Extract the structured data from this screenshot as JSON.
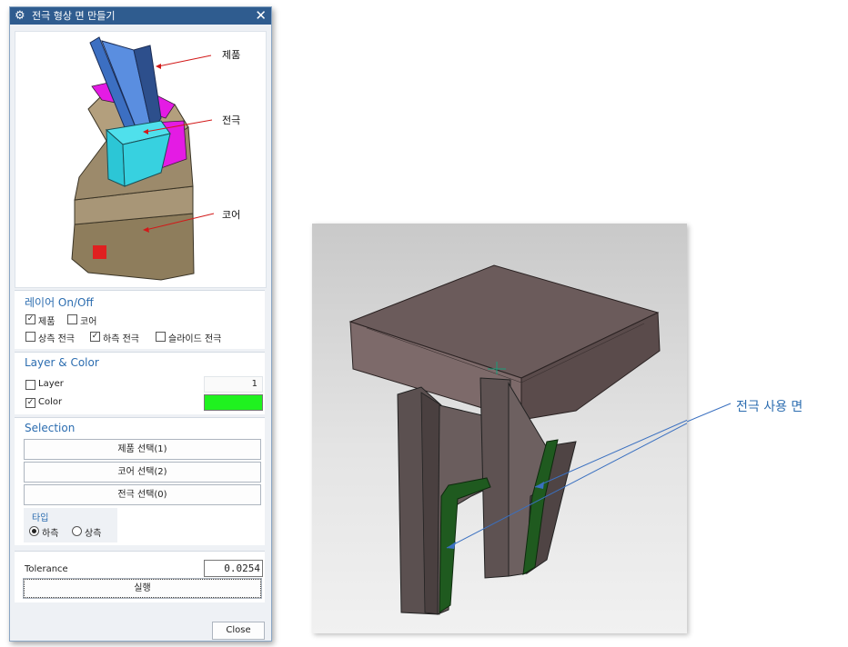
{
  "dialog": {
    "title": "전극 형상 면 만들기",
    "close_glyph": "✕",
    "gear_glyph": "⚙",
    "preview_labels": {
      "product": "제품",
      "electrode": "전극",
      "core": "코어"
    }
  },
  "layer_onoff": {
    "title": "레이어 On/Off",
    "items": [
      {
        "label": "제품",
        "checked": true
      },
      {
        "label": "코어",
        "checked": false
      },
      {
        "label": "상측 전극",
        "checked": false
      },
      {
        "label": "하측 전극",
        "checked": true
      },
      {
        "label": "슬라이드 전극",
        "checked": false
      }
    ]
  },
  "layer_color": {
    "title": "Layer & Color",
    "layer_label": "Layer",
    "layer_checked": false,
    "layer_value": "1",
    "color_label": "Color",
    "color_checked": true,
    "color_value": "#1ff21f"
  },
  "selection": {
    "title": "Selection",
    "buttons": [
      "제품 선택(1)",
      "코어 선택(2)",
      "전극 선택(0)"
    ],
    "type_group": {
      "title": "타입",
      "options": [
        {
          "label": "하측",
          "selected": true
        },
        {
          "label": "상측",
          "selected": false
        }
      ]
    }
  },
  "tolerance": {
    "label": "Tolerance",
    "value": "0.0254"
  },
  "run_button": "실행",
  "close_button": "Close",
  "annotation": {
    "text": "전극 사용 면"
  },
  "check_glyph": "✓",
  "colors": {
    "titlebar": "#2f5c8f",
    "accent": "#2c6db0",
    "electrode_face": "#1f5a1f"
  }
}
